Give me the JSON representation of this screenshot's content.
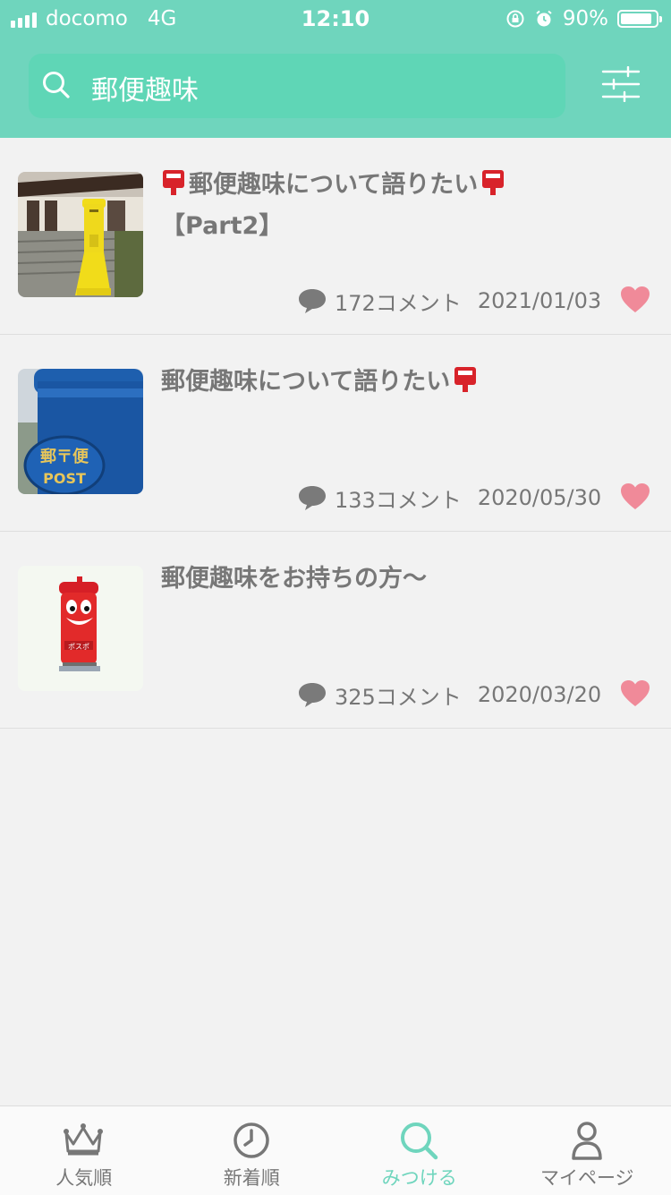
{
  "status_bar": {
    "carrier": "docomo",
    "network": "4G",
    "time": "12:10",
    "battery": "90%",
    "battery_level": 0.9
  },
  "search": {
    "query": "郵便趣味"
  },
  "colors": {
    "accent": "#6fd5bd",
    "search_bg": "#5fd6b6",
    "heart": "#f08a99"
  },
  "threads": [
    {
      "title_line1": "郵便趣味について語りたい",
      "title_line2": "【Part2】",
      "comments": "172コメント",
      "date": "2021/01/03"
    },
    {
      "title_line1": "郵便趣味について語りたい",
      "title_line2": "",
      "comments": "133コメント",
      "date": "2020/05/30"
    },
    {
      "title_line1": "郵便趣味をお持ちの方〜",
      "title_line2": "",
      "comments": "325コメント",
      "date": "2020/03/20"
    }
  ],
  "thumbnail_texts": {
    "blue_post_upper": "郵〒便",
    "blue_post_lower": "POST",
    "red_post_label": "ポスポ"
  },
  "tabs": [
    {
      "label": "人気順",
      "icon": "crown-icon"
    },
    {
      "label": "新着順",
      "icon": "clock-icon"
    },
    {
      "label": "みつける",
      "icon": "search-icon"
    },
    {
      "label": "マイページ",
      "icon": "person-icon"
    }
  ]
}
